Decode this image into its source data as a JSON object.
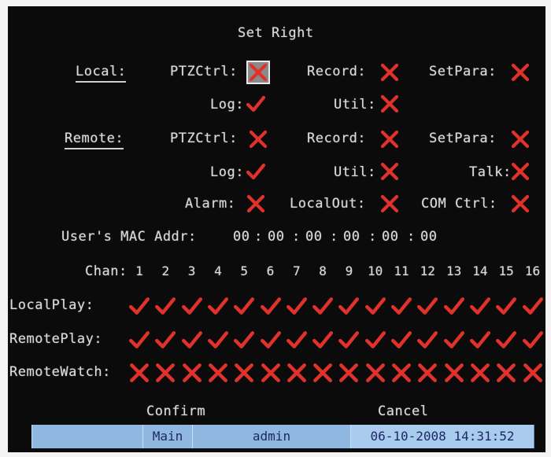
{
  "title": "Set Right",
  "local": {
    "label": "Local:",
    "ptz_label": "PTZCtrl:",
    "ptz_state": "cross",
    "record_label": "Record:",
    "record_state": "cross",
    "setpara_label": "SetPara:",
    "setpara_state": "cross",
    "log_label": "Log:",
    "log_state": "check",
    "util_label": "Util:",
    "util_state": "cross"
  },
  "remote": {
    "label": "Remote:",
    "ptz_label": "PTZCtrl:",
    "ptz_state": "cross",
    "record_label": "Record:",
    "record_state": "cross",
    "setpara_label": "SetPara:",
    "setpara_state": "cross",
    "log_label": "Log:",
    "log_state": "check",
    "util_label": "Util:",
    "util_state": "cross",
    "talk_label": "Talk:",
    "talk_state": "cross",
    "alarm_label": "Alarm:",
    "alarm_state": "cross",
    "localout_label": "LocalOut:",
    "localout_state": "cross",
    "comctrl_label": "COM Ctrl:",
    "comctrl_state": "cross"
  },
  "mac": {
    "label": "User's MAC Addr:",
    "octets": [
      "00",
      "00",
      "00",
      "00",
      "00",
      "00"
    ],
    "separator": ":"
  },
  "channels": {
    "label": "Chan:",
    "numbers": [
      "1",
      "2",
      "3",
      "4",
      "5",
      "6",
      "7",
      "8",
      "9",
      "10",
      "11",
      "12",
      "13",
      "14",
      "15",
      "16"
    ]
  },
  "rows": [
    {
      "label": "LocalPlay:",
      "states": [
        "check",
        "check",
        "check",
        "check",
        "check",
        "check",
        "check",
        "check",
        "check",
        "check",
        "check",
        "check",
        "check",
        "check",
        "check",
        "check"
      ]
    },
    {
      "label": "RemotePlay:",
      "states": [
        "check",
        "check",
        "check",
        "check",
        "check",
        "check",
        "check",
        "check",
        "check",
        "check",
        "check",
        "check",
        "check",
        "check",
        "check",
        "check"
      ]
    },
    {
      "label": "RemoteWatch:",
      "states": [
        "cross",
        "cross",
        "cross",
        "cross",
        "cross",
        "cross",
        "cross",
        "cross",
        "cross",
        "cross",
        "cross",
        "cross",
        "cross",
        "cross",
        "cross",
        "cross"
      ]
    }
  ],
  "buttons": {
    "confirm": "Confirm",
    "cancel": "Cancel"
  },
  "status_bar": {
    "menu": "Main",
    "user": "admin",
    "datetime": "06-10-2008 14:31:52"
  },
  "colors": {
    "background": "#0b0b0c",
    "text": "#d9d9d9",
    "mark": "#e0312a",
    "status_bar": "#8fb7df",
    "status_text": "#1d2a66"
  },
  "icons": {
    "check": "check-icon",
    "cross": "cross-icon"
  }
}
